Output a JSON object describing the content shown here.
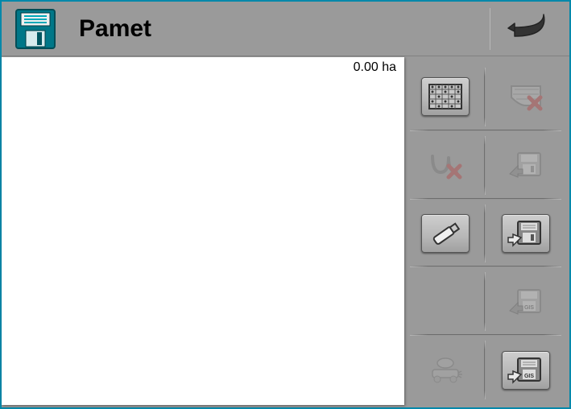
{
  "header": {
    "title": "Pamet",
    "icon": "save-floppy"
  },
  "main": {
    "area_value": "0.00 ha"
  },
  "sidebar": {
    "buttons": [
      {
        "name": "field-pattern",
        "enabled": true
      },
      {
        "name": "field-delete",
        "enabled": false
      },
      {
        "name": "track-delete",
        "enabled": false
      },
      {
        "name": "save-import",
        "enabled": false
      },
      {
        "name": "usb",
        "enabled": true
      },
      {
        "name": "save-export",
        "enabled": true
      },
      {
        "name": "gis-import",
        "enabled": false
      },
      {
        "name": "machine",
        "enabled": false
      },
      {
        "name": "gis-export",
        "enabled": true
      }
    ]
  },
  "colors": {
    "frame": "#0088aa",
    "panel": "#9a9a9a",
    "accent_teal": "#00aabb"
  }
}
